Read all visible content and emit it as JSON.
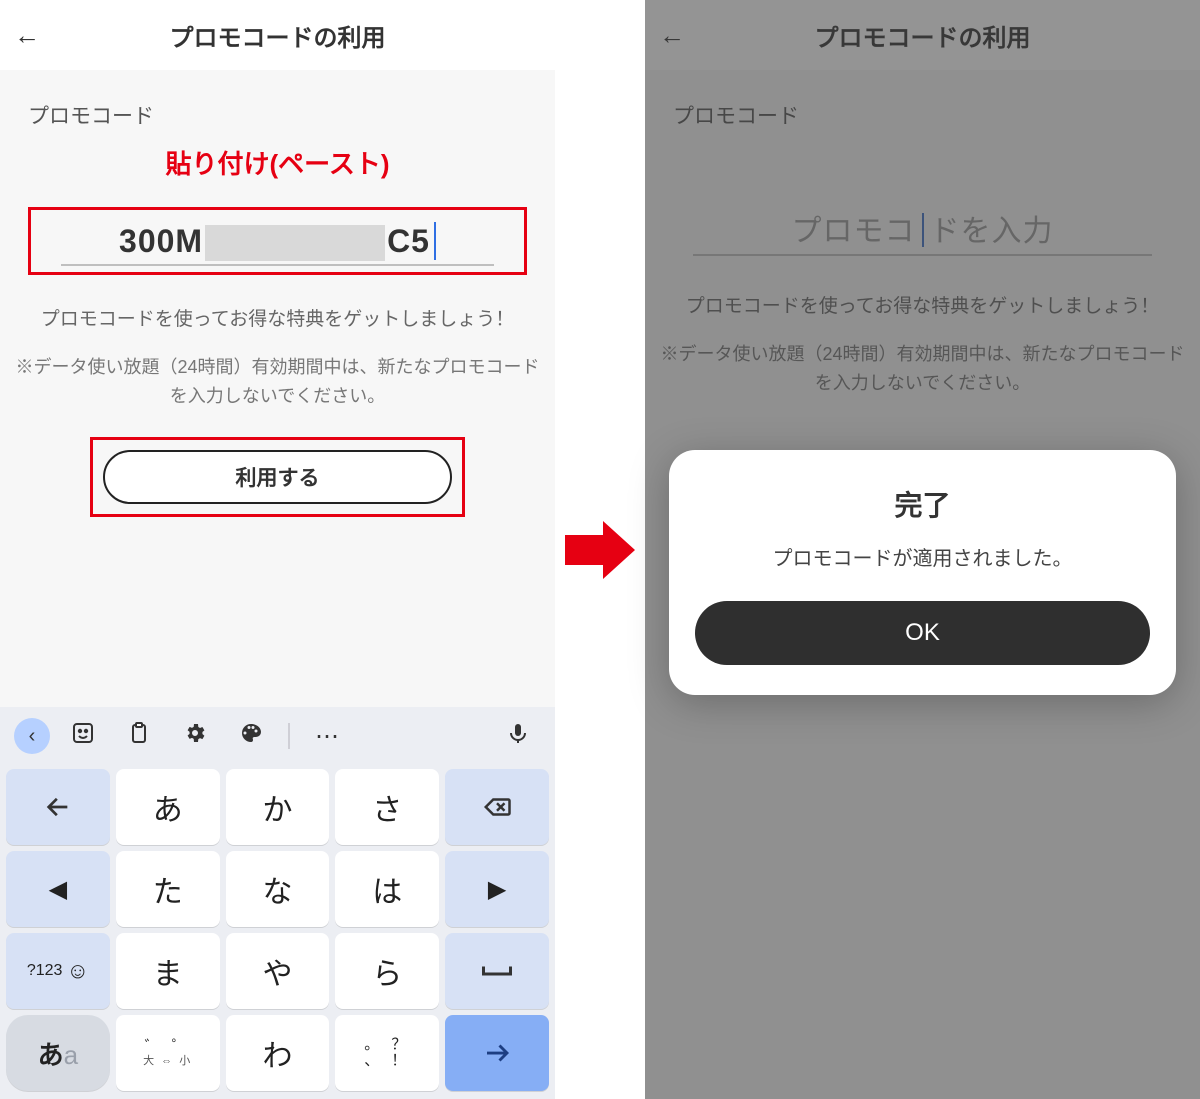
{
  "icons": {
    "back": "←"
  },
  "left": {
    "title": "プロモコードの利用",
    "field_label": "プロモコード",
    "annotation_paste": "貼り付け(ペースト)",
    "code_prefix": "300M",
    "code_suffix": "C5",
    "hint1": "プロモコードを使ってお得な特典をゲットしましょう！",
    "hint2": "※データ使い放題（24時間）有効期間中は、新たなプロモコードを入力しないでください。",
    "apply_label": "利用する"
  },
  "right": {
    "title": "プロモコードの利用",
    "field_label": "プロモコード",
    "placeholder_left": "プロモコ",
    "placeholder_right": "ドを入力",
    "hint1": "プロモコードを使ってお得な特典をゲットしましょう！",
    "hint2": "※データ使い放題（24時間）有効期間中は、新たなプロモコードを入力しないでください。",
    "dialog_title": "完了",
    "dialog_body": "プロモコードが適用されました。",
    "dialog_ok": "OK"
  },
  "kbd": {
    "toolbar": [
      "‹",
      "☺",
      "📋",
      "⚙",
      "🎨",
      "⋯",
      "🎤"
    ],
    "rows": [
      [
        "←",
        "あ",
        "か",
        "さ",
        "⌫"
      ],
      [
        "◀",
        "た",
        "な",
        "は",
        "▶"
      ],
      [
        "?123 ☺",
        "ま",
        "や",
        "ら",
        "␣"
      ],
      [
        "あa",
        "大⇔小",
        "わ",
        "、。?!",
        "↵"
      ]
    ],
    "size_label": "大 ⇔ 小",
    "punct_top": "。 ？",
    "punct_bot": "、  ！",
    "num_mode": "?123",
    "sub_on_size_top": "゛  ゜"
  }
}
